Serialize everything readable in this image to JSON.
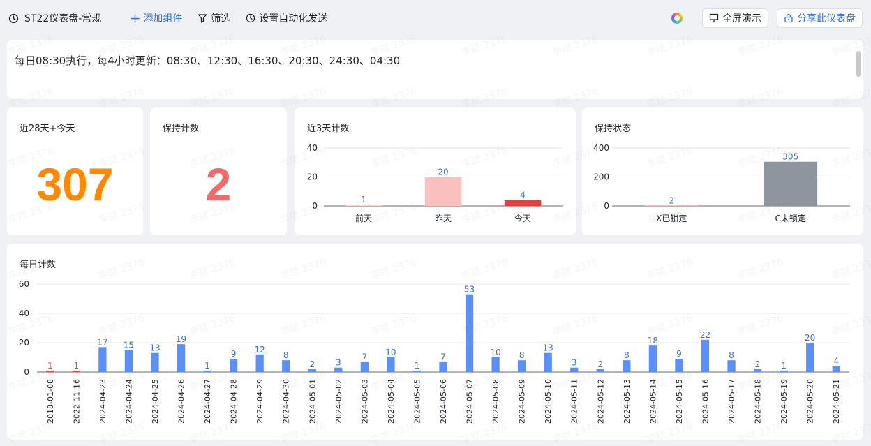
{
  "toolbar": {
    "title": "ST22仪表盘-常规",
    "add_component": "添加组件",
    "filter": "筛选",
    "automation": "设置自动化发送",
    "fullscreen": "全屏演示",
    "share": "分享此仪表盘"
  },
  "notice": {
    "text": "每日08:30执行，每4小时更新：08:30、12:30、16:30、20:30、24:30、04:30"
  },
  "kpis": [
    {
      "title": "近28天+今天",
      "value": "307",
      "color": "#ff8800"
    },
    {
      "title": "保持计数",
      "value": "2",
      "color": "#f26a6a"
    }
  ],
  "watermark": "李斌 2376",
  "chart_data": [
    {
      "type": "bar",
      "title": "近3天计数",
      "categories": [
        "前天",
        "昨天",
        "今天"
      ],
      "values": [
        1,
        20,
        4
      ],
      "colors": [
        "#fcd6c8",
        "#f9c0bd",
        "#e8413d"
      ],
      "ylim": [
        0,
        40
      ],
      "yticks": [
        0,
        20,
        40
      ],
      "grid": true
    },
    {
      "type": "bar",
      "title": "保持状态",
      "categories": [
        "X已锁定",
        "C未锁定"
      ],
      "values": [
        2,
        305
      ],
      "colors": [
        "#f9c0bd",
        "#8f959e"
      ],
      "ylim": [
        0,
        400
      ],
      "yticks": [
        0,
        200,
        400
      ],
      "grid": true
    },
    {
      "type": "bar",
      "title": "每日计数",
      "categories": [
        "2018-01-08",
        "2022-11-16",
        "2024-04-23",
        "2024-04-24",
        "2024-04-25",
        "2024-04-26",
        "2024-04-27",
        "2024-04-28",
        "2024-04-29",
        "2024-04-30",
        "2024-05-01",
        "2024-05-02",
        "2024-05-03",
        "2024-05-04",
        "2024-05-05",
        "2024-05-06",
        "2024-05-07",
        "2024-05-08",
        "2024-05-09",
        "2024-05-10",
        "2024-05-11",
        "2024-05-12",
        "2024-05-13",
        "2024-05-14",
        "2024-05-15",
        "2024-05-16",
        "2024-05-17",
        "2024-05-18",
        "2024-05-19",
        "2024-05-20",
        "2024-05-21"
      ],
      "values": [
        1,
        1,
        17,
        15,
        13,
        19,
        1,
        9,
        12,
        8,
        2,
        3,
        7,
        10,
        1,
        7,
        53,
        10,
        8,
        13,
        3,
        2,
        8,
        18,
        9,
        22,
        8,
        2,
        1,
        20,
        4
      ],
      "colors": [
        "#e8413d",
        "#e8413d",
        "#5b8ff9",
        "#5b8ff9",
        "#5b8ff9",
        "#5b8ff9",
        "#5b8ff9",
        "#5b8ff9",
        "#5b8ff9",
        "#5b8ff9",
        "#5b8ff9",
        "#5b8ff9",
        "#5b8ff9",
        "#5b8ff9",
        "#5b8ff9",
        "#5b8ff9",
        "#5b8ff9",
        "#5b8ff9",
        "#5b8ff9",
        "#5b8ff9",
        "#5b8ff9",
        "#5b8ff9",
        "#5b8ff9",
        "#5b8ff9",
        "#5b8ff9",
        "#5b8ff9",
        "#5b8ff9",
        "#5b8ff9",
        "#5b8ff9",
        "#5b8ff9",
        "#5b8ff9"
      ],
      "label_colors": [
        "#e8413d",
        "#e8413d",
        "#3d6fd9"
      ],
      "ylim": [
        0,
        60
      ],
      "yticks": [
        0,
        20,
        40,
        60
      ],
      "grid": true
    }
  ]
}
